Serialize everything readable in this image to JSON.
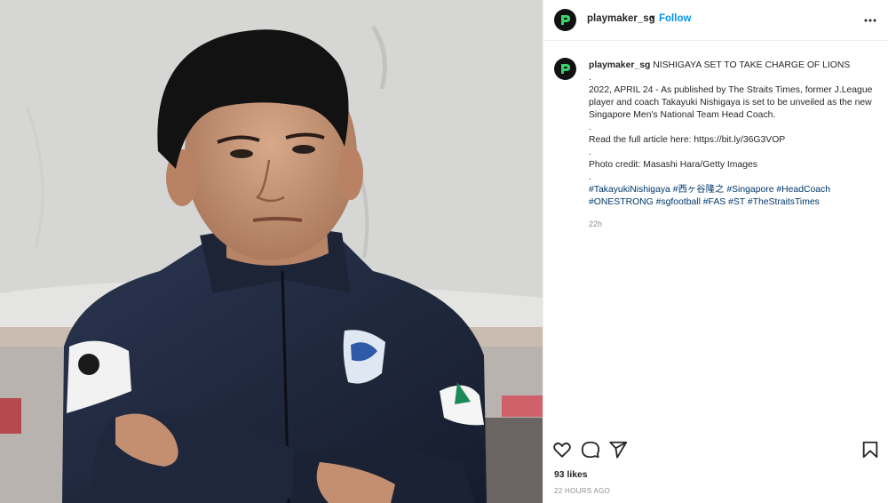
{
  "post": {
    "username": "playmaker_sg",
    "separator": "•",
    "follow_label": "Follow",
    "more_icon": "more-horizontal-icon"
  },
  "caption": {
    "username": "playmaker_sg",
    "headline": "NISHIGAYA SET TO TAKE CHARGE OF LIONS",
    "dot1": ".",
    "body": "2022, APRIL 24 - As published by The Straits Times, former J.League player and coach Takayuki Nishigaya is set to be unveiled as the new Singapore Men's National Team Head Coach.",
    "dot2": ".",
    "read_more": "Read the full article here: https://bit.ly/36G3VOP",
    "dot3": ".",
    "credit": "Photo credit: Masashi Hara/Getty Images",
    "dot4": ".",
    "hashtags": "#TakayukiNishigaya #西ヶ谷隆之 #Singapore #HeadCoach #ONESTRONG #sgfootball #FAS #ST #TheStraitsTimes",
    "age": "22h"
  },
  "footer": {
    "likes": "93 likes",
    "posted": "22 HOURS AGO"
  },
  "colors": {
    "accent": "#0095f6",
    "hashtag": "#00376b",
    "muted": "#8e8e8e",
    "avatar_bg": "#111111",
    "avatar_mark": "#3ad36b"
  }
}
